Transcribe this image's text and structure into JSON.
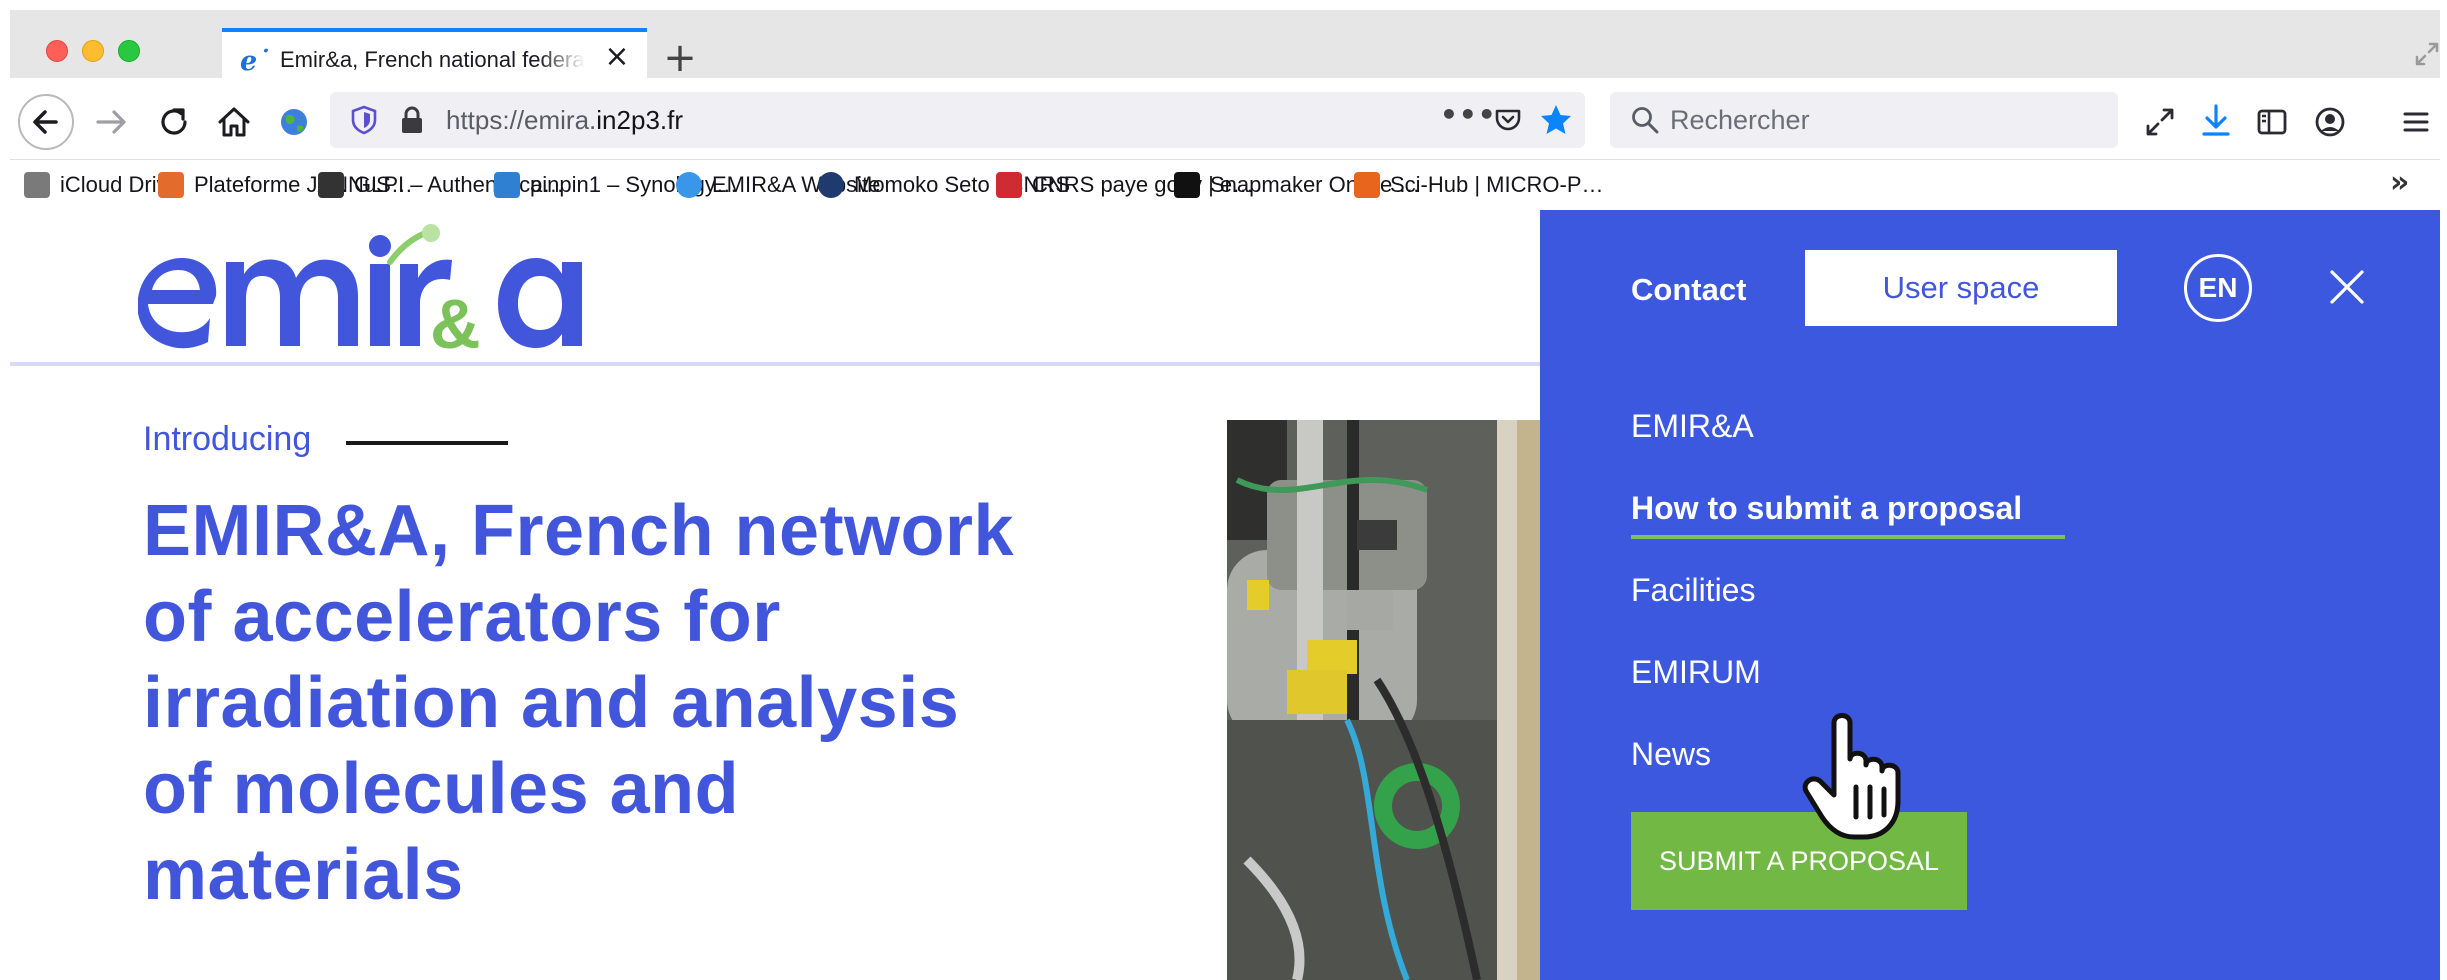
{
  "browser": {
    "tab": {
      "title": "Emir&a, French national federation",
      "favicon": "e˙"
    },
    "new_tab": "+",
    "url": {
      "prefix": "https://emira.",
      "domain": "in2p3.fr"
    },
    "url_more": "•••",
    "search_placeholder": "Rechercher",
    "bookmarks": [
      {
        "label": "iCloud Drive",
        "icon": "apple-icon",
        "color": "#7a7a7a"
      },
      {
        "label": "Plateforme JANNuS…",
        "icon": "jannus-icon",
        "color": "#e36b2c"
      },
      {
        "label": "GLPI – Authentifica…",
        "icon": "glpi-icon",
        "color": "#333333"
      },
      {
        "label": "pinpin1 – Synology…",
        "icon": "dsm-icon",
        "color": "#2f7fd3"
      },
      {
        "label": "EMIR&A Website",
        "icon": "globe-icon",
        "color": "#3a96e8"
      },
      {
        "label": "Momoko Seto | CNRS",
        "icon": "cnrs-icon",
        "color": "#1e3a6e"
      },
      {
        "label": "CNRS paye gouv | e…",
        "icon": "gouv-icon",
        "color": "#cf2b33"
      },
      {
        "label": "Snapmaker Online …",
        "icon": "snapmaker-icon",
        "color": "#111111"
      },
      {
        "label": "Sci-Hub | MICRO-P…",
        "icon": "scihub-icon",
        "color": "#e8651e"
      }
    ],
    "bookmarks_overflow": "»"
  },
  "site": {
    "intro": "Introducing",
    "hero_lines": [
      "EMIR&A, French network",
      "of accelerators for",
      "irradiation and analysis",
      "of molecules and",
      "materials"
    ],
    "brand_color": "#4256dc",
    "accent_green": "#72b844"
  },
  "menu": {
    "contact": "Contact",
    "user_space": "User space",
    "language": "EN",
    "items": [
      "EMIR&A",
      "How to submit a proposal",
      "Facilities",
      "EMIRUM",
      "News"
    ],
    "submit_button": "SUBMIT A PROPOSAL",
    "panel_color": "#3c58df"
  }
}
